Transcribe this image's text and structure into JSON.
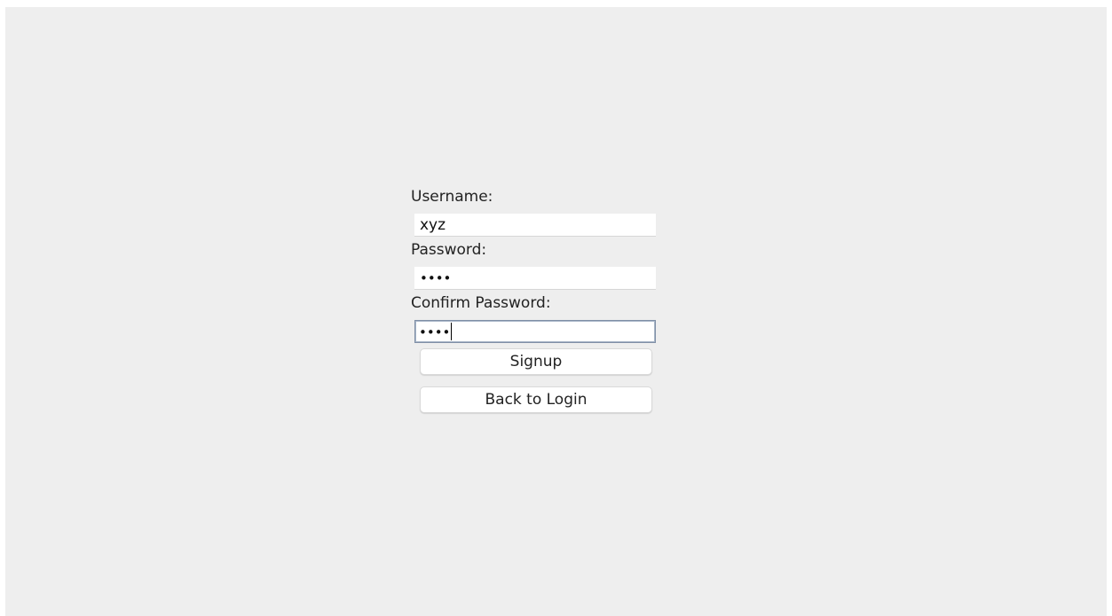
{
  "form": {
    "username_label": "Username:",
    "username_value": "xyz",
    "password_label": "Password:",
    "password_value": "••••",
    "confirm_label": "Confirm Password:",
    "confirm_value": "••••",
    "signup_button": "Signup",
    "back_button": "Back to Login"
  }
}
